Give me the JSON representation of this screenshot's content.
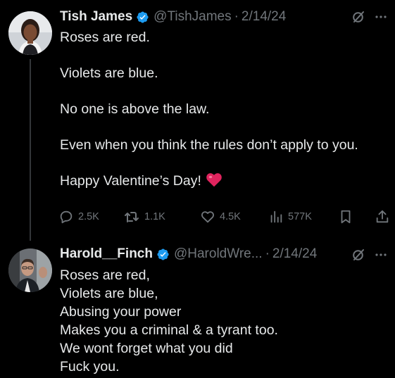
{
  "posts": [
    {
      "author": "Tish James",
      "handle": "@TishJames",
      "date": "2/14/24",
      "lines": [
        "Roses are red.",
        "Violets are blue.",
        "No one is above the law.",
        "Even when you think the rules don’t apply to you.",
        "Happy Valentine’s Day!"
      ],
      "emoji": "heart-emoji",
      "stats": {
        "replies": "2.5K",
        "reposts": "1.1K",
        "likes": "4.5K",
        "views": "577K"
      }
    },
    {
      "author": "Harold__Finch",
      "handle": "@HaroldWre...",
      "date": "2/14/24",
      "lines": [
        "Roses are red,",
        "Violets are blue,",
        "Abusing your power",
        "Makes you a criminal & a tyrant too.",
        "We wont forget what you did",
        "Fuck you."
      ]
    }
  ],
  "separator": "·",
  "colors": {
    "background": "#000000",
    "text": "#e7e9ea",
    "muted": "#71767b",
    "verified": "#1d9bf0",
    "heart": "#e0245e",
    "thread_line": "#333639"
  }
}
